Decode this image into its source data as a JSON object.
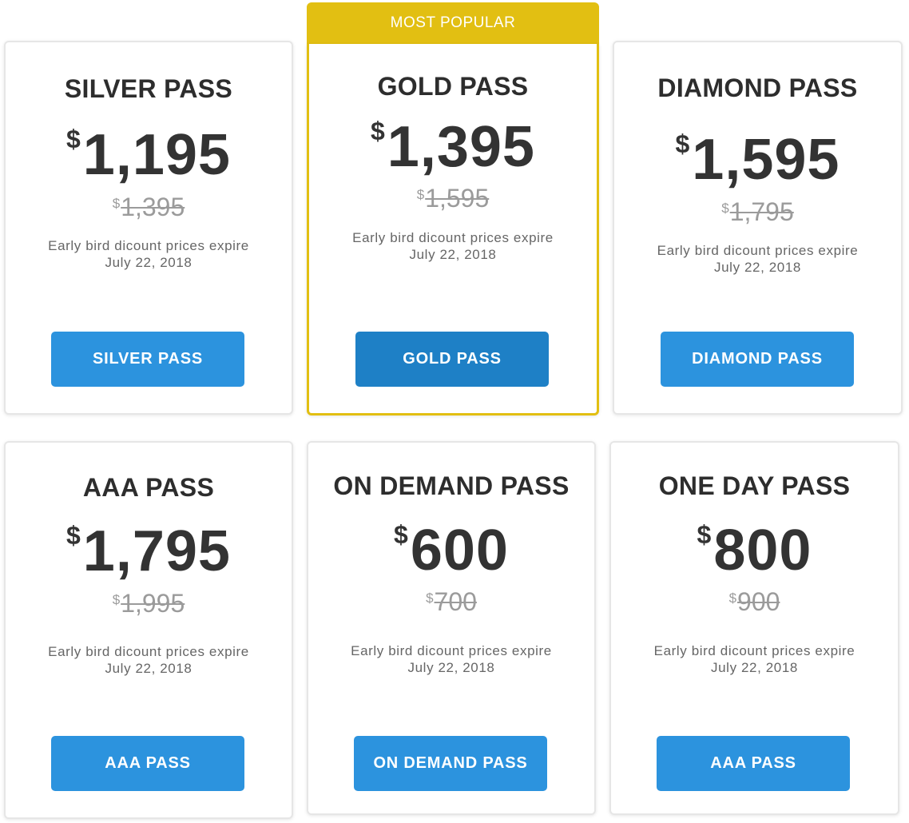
{
  "ribbon_label": "MOST POPULAR",
  "currency_symbol": "$",
  "cards": [
    {
      "title": "SILVER PASS",
      "price": "1,195",
      "old_price": "1,395",
      "note_line1": "Early bird dicount prices expire",
      "note_line2": "July 22, 2018",
      "button": "SILVER PASS"
    },
    {
      "title": "GOLD PASS",
      "price": "1,395",
      "old_price": "1,595",
      "note_line1": "Early bird dicount prices expire",
      "note_line2": "July 22, 2018",
      "button": "GOLD PASS"
    },
    {
      "title": "DIAMOND PASS",
      "price": "1,595",
      "old_price": "1,795",
      "note_line1": "Early bird dicount prices expire",
      "note_line2": "July 22, 2018",
      "button": "DIAMOND PASS"
    },
    {
      "title": "AAA PASS",
      "price": "1,795",
      "old_price": "1,995",
      "note_line1": "Early bird dicount prices expire",
      "note_line2": "July 22, 2018",
      "button": "AAA PASS"
    },
    {
      "title": "ON DEMAND PASS",
      "price": "600",
      "old_price": "700",
      "note_line1": "Early bird dicount prices expire",
      "note_line2": "July 22, 2018",
      "button": "ON DEMAND PASS"
    },
    {
      "title": "ONE DAY PASS",
      "price": "800",
      "old_price": "900",
      "note_line1": "Early bird dicount prices expire",
      "note_line2": "July 22, 2018",
      "button": "AAA PASS"
    }
  ],
  "colors": {
    "button": "#2c93de",
    "button_featured": "#1e80c6",
    "highlight": "#e2bf12",
    "text_dark": "#333333",
    "text_muted": "#9b9b9b"
  }
}
